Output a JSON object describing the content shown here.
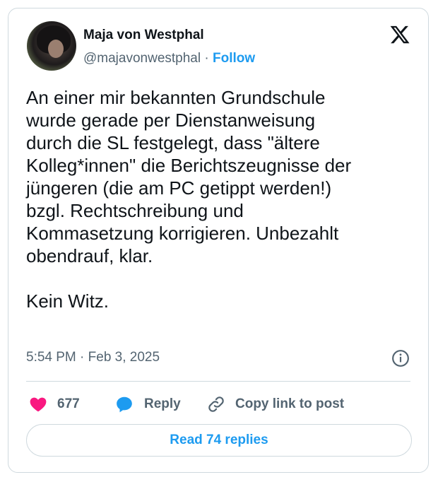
{
  "author": {
    "name": "Maja von Westphal",
    "handle": "@majavonwestphal",
    "separator": "·",
    "follow_label": "Follow"
  },
  "tweet": {
    "text": "An einer mir bekannten Grundschule\nwurde gerade per Dienstanweisung\ndurch die SL festgelegt, dass \"ältere\nKolleg*innen\" die Berichtszeugnisse der\njüngeren (die am PC getippt werden!)\nbzgl. Rechtschreibung und\nKommasetzung korrigieren. Unbezahlt\nobendrauf, klar.\n\nKein Witz.",
    "timestamp": "5:54 PM · Feb 3, 2025"
  },
  "actions": {
    "like_count": "677",
    "reply_label": "Reply",
    "copy_label": "Copy link to post"
  },
  "footer": {
    "read_replies_label": "Read 74 replies"
  },
  "icons": {
    "logo": "x-logo-icon",
    "info": "info-icon",
    "like": "heart-icon",
    "reply": "speech-bubble-icon",
    "copy": "link-icon"
  },
  "colors": {
    "accent": "#1d9bf0",
    "like": "#f91880",
    "muted": "#536471",
    "border": "#cfd9de"
  }
}
